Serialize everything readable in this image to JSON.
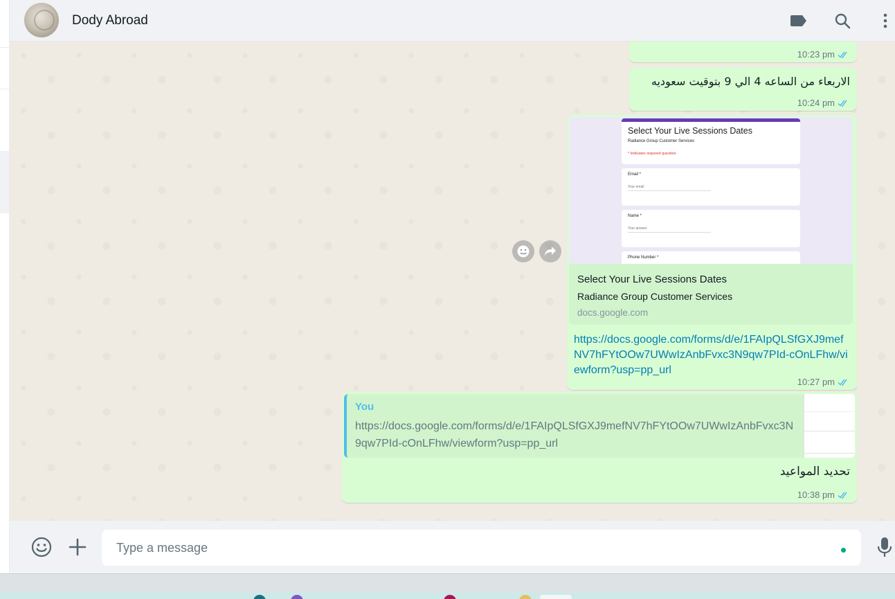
{
  "header": {
    "contact_name": "Dody Abroad",
    "icons": [
      "label-icon",
      "search-icon",
      "menu-icon"
    ]
  },
  "messages": [
    {
      "id": "m1",
      "text": "",
      "time": "10:23 pm",
      "status": "read"
    },
    {
      "id": "m2",
      "text": "الاربعاء من الساعه 4 الي 9 بتوقيت سعوديه",
      "time": "10:24 pm",
      "status": "read"
    },
    {
      "id": "m3",
      "link_preview": {
        "thumbnail": {
          "form_title": "Select Your Live Sessions Dates",
          "form_subtitle": "Radiance Group Customer Services",
          "required_note": "* Indicates required question",
          "fields": [
            {
              "label": "Email *",
              "placeholder": "Your email"
            },
            {
              "label": "Name *",
              "placeholder": "Your answer"
            },
            {
              "label": "Phone Number *",
              "placeholder": ""
            }
          ]
        },
        "title": "Select Your Live Sessions Dates",
        "description": "Radiance Group Customer Services",
        "domain": "docs.google.com"
      },
      "link_text": "https://docs.google.com/forms/d/e/1FAIpQLSfGXJ9mefNV7hFYtOOw7UWwIzAnbFvxc3N9qw7PId-cOnLFhw/viewform?usp=pp_url",
      "time": "10:27 pm",
      "status": "read"
    },
    {
      "id": "m4",
      "quote": {
        "author": "You",
        "text": "https://docs.google.com/forms/d/e/1FAIpQLSfGXJ9mefNV7hFYtOOw7UWwIzAnbFvxc3N9qw7PId-cOnLFhw/viewform?usp=pp_url"
      },
      "text": "تحديد المواعيد",
      "time": "10:38 pm",
      "status": "read"
    }
  ],
  "hover_actions": [
    "emoji-react-icon",
    "forward-icon"
  ],
  "composer": {
    "placeholder": "Type a message",
    "icons": [
      "emoji-icon",
      "attach-plus-icon",
      "mic-icon"
    ]
  },
  "colors": {
    "outgoing_bubble": "#d9fdd3",
    "link": "#027eb5",
    "read_ticks": "#53bdeb",
    "quote_accent": "#53bdeb",
    "header_bg": "#f0f2f5",
    "chat_bg": "#efeae2"
  }
}
